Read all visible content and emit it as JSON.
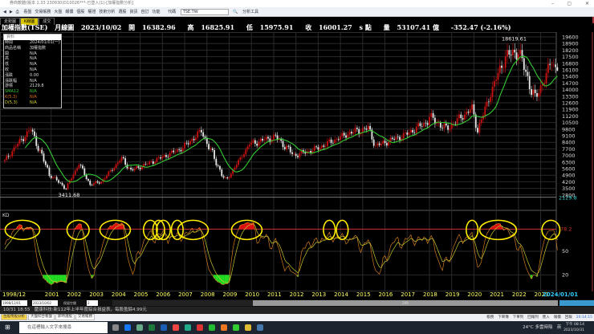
{
  "window": {
    "title": "券商軟體(版本 1.33 230930)D10026***-已登入(1)-[加權指數分析]",
    "min": "–",
    "max": "▢",
    "close": "✕"
  },
  "toolbar": {
    "items": [
      "看盤",
      "交易帳務",
      "大盤",
      "報價",
      "個股",
      "權證",
      "技術分析",
      "選股",
      "資訊",
      "自訂",
      "功能"
    ],
    "symbol_label": "代碼",
    "symbol_value": "TSE.TW",
    "analysis_tools": "分析工具"
  },
  "tabs": [
    {
      "label": "走勢圖",
      "active": false
    },
    {
      "label": "K線圖",
      "active": true
    },
    {
      "label": "成交",
      "active": false
    }
  ],
  "info": {
    "name": "加權指數(TSE)",
    "period": "月線圖",
    "date": "2023/10/02",
    "open_label": "開",
    "open": "16382.96",
    "high_label": "高",
    "high": "16825.91",
    "low_label": "低",
    "low": "15975.91",
    "close_label": "收",
    "close": "16001.27",
    "unit": "s 點",
    "volume_label": "量",
    "volume": "53107.41 億",
    "change": "-352.47 (-2.16%)"
  },
  "panel": {
    "header": "資料",
    "rows": [
      {
        "k": "時間",
        "v": "2024/01/01(一)"
      },
      {
        "k": "商品名稱",
        "v": "加權指數"
      },
      {
        "k": "開",
        "v": "N/A"
      },
      {
        "k": "高",
        "v": "N/A"
      },
      {
        "k": "低",
        "v": "N/A"
      },
      {
        "k": "收",
        "v": "N/A"
      },
      {
        "k": "漲跌",
        "v": "0.00"
      },
      {
        "k": "漲跌幅",
        "v": "N/A"
      },
      {
        "k": "游標",
        "v": "2129.8"
      },
      {
        "k": "SMA12",
        "v": "N/A",
        "color": "#33cc33"
      },
      {
        "k": "K(5,3)",
        "v": "N/A",
        "color": "#e07020"
      },
      {
        "k": "D(5,3)",
        "v": "N/A",
        "color": "#d8d830"
      }
    ]
  },
  "colors": {
    "up": "#cc1111",
    "down": "#e8e8e8",
    "sma": "#33cc33",
    "k": "#d07a20",
    "d": "#c8c830",
    "grid": "#2a2a2a",
    "highlight": "#ffee00",
    "ref": "#cc3333"
  },
  "chart_data": {
    "type": "candlestick",
    "period": "monthly",
    "start": "1998/12",
    "end": "2023/10",
    "close_anchors": [
      [
        "1998/12",
        6400
      ],
      [
        "1999/06",
        8000
      ],
      [
        "2000/02",
        9800
      ],
      [
        "2000/12",
        5000
      ],
      [
        "2001/09",
        3500
      ],
      [
        "2002/04",
        6100
      ],
      [
        "2002/10",
        3900
      ],
      [
        "2003/04",
        4200
      ],
      [
        "2004/03",
        6700
      ],
      [
        "2004/08",
        5400
      ],
      [
        "2005/06",
        6200
      ],
      [
        "2006/12",
        7800
      ],
      [
        "2007/10",
        9600
      ],
      [
        "2008/11",
        4200
      ],
      [
        "2009/12",
        8200
      ],
      [
        "2011/02",
        9000
      ],
      [
        "2011/12",
        7000
      ],
      [
        "2012/12",
        7700
      ],
      [
        "2014/06",
        9400
      ],
      [
        "2015/04",
        9900
      ],
      [
        "2015/08",
        8000
      ],
      [
        "2016/12",
        9200
      ],
      [
        "2017/12",
        10600
      ],
      [
        "2018/01",
        11100
      ],
      [
        "2018/10",
        9800
      ],
      [
        "2019/12",
        12000
      ],
      [
        "2020/03",
        9700
      ],
      [
        "2020/12",
        14700
      ],
      [
        "2021/06",
        17500
      ],
      [
        "2022/01",
        18100
      ],
      [
        "2022/10",
        12900
      ],
      [
        "2023/07",
        17000
      ],
      [
        "2023/10",
        16001
      ]
    ],
    "annotations": {
      "high": "18619.61",
      "low": "3411.68"
    },
    "y_ticks": [
      19600,
      18900,
      18200,
      17500,
      16800,
      16100,
      15400,
      14700,
      14000,
      13300,
      12600,
      11900,
      11200,
      10500,
      9800,
      9100,
      8400,
      7700,
      7000,
      6300,
      5600,
      4900,
      4200,
      3500,
      2800
    ],
    "ylim": [
      2800,
      19600
    ],
    "cursor_value": "2129.8",
    "indicator": {
      "name": "SMA12"
    },
    "kd": {
      "label": "KD",
      "ref_level": "78.2",
      "ticks": [
        "50",
        "20"
      ],
      "ylim": [
        0,
        100
      ]
    },
    "x_ticks": [
      "1998/12",
      "2001",
      "2002",
      "2003",
      "2004",
      "2005",
      "2006",
      "2007",
      "2008",
      "2009",
      "2010",
      "2011",
      "2012",
      "2013",
      "2014",
      "2015",
      "2016",
      "2017",
      "2018",
      "2019",
      "2020",
      "2021",
      "2022",
      "2023",
      "2024/01/01"
    ]
  },
  "controls": {
    "from": "1998/12/01",
    "to": "2023/10/02",
    "keep_label": "保留空間",
    "keep_value": "2",
    "count": "299"
  },
  "ticker": {
    "time": "10/31 18:55",
    "text": "慶康科技:新112年上半年度綜合損益表，每股盈餘4.99元"
  },
  "bottom_tabs": [
    {
      "label": "台股幣股分析",
      "active": true
    },
    {
      "label": "大盤綜合看盤",
      "active": false
    },
    {
      "label": "即時選股",
      "active": false
    },
    {
      "label": "交易帳務",
      "active": false
    }
  ],
  "status": {
    "items": [
      "帳務",
      "下單簿",
      "下單列",
      "回報列",
      "匯入",
      "報價",
      "回報"
    ],
    "time": "20:14:15"
  },
  "taskbar": {
    "search_placeholder": "在這裡輸入文字來搜尋",
    "weather": "24°C 多雲時陰",
    "ime": "英",
    "time": "下午 08:14",
    "date": "2023/10/31"
  }
}
